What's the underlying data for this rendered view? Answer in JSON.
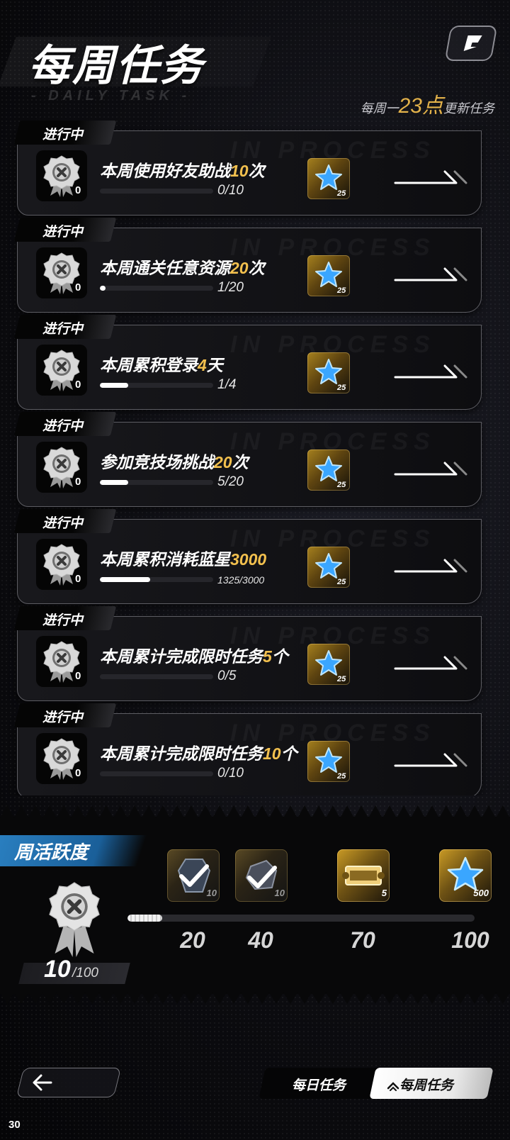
{
  "header": {
    "title": "每周任务",
    "subtitle_deco": "- DAILY TASK -",
    "reset_prefix": "每周一",
    "reset_hour": "23点",
    "reset_suffix": "更新任务"
  },
  "status_label": "进行中",
  "card_watermark": "IN PROCESS",
  "tasks": [
    {
      "name_pre": "本周使用好友助战",
      "name_hl": "10",
      "name_post": "次",
      "medal_count": "0",
      "progress_text": "0/10",
      "current": 0,
      "target": 10,
      "reward_count": "25"
    },
    {
      "name_pre": "本周通关任意资源",
      "name_hl": "20",
      "name_post": "次",
      "medal_count": "0",
      "progress_text": "1/20",
      "current": 1,
      "target": 20,
      "reward_count": "25"
    },
    {
      "name_pre": "本周累积登录",
      "name_hl": "4",
      "name_post": "天",
      "medal_count": "0",
      "progress_text": "1/4",
      "current": 1,
      "target": 4,
      "reward_count": "25"
    },
    {
      "name_pre": "参加竞技场挑战",
      "name_hl": "20",
      "name_post": "次",
      "medal_count": "0",
      "progress_text": "5/20",
      "current": 5,
      "target": 20,
      "reward_count": "25"
    },
    {
      "name_pre": "本周累积消耗蓝星",
      "name_hl": "3000",
      "name_post": "",
      "medal_count": "0",
      "progress_text": "1325/3000",
      "current": 1325,
      "target": 3000,
      "reward_count": "25"
    },
    {
      "name_pre": "本周累计完成限时任务",
      "name_hl": "5",
      "name_post": "个",
      "medal_count": "0",
      "progress_text": "0/5",
      "current": 0,
      "target": 5,
      "reward_count": "25"
    },
    {
      "name_pre": "本周累计完成限时任务",
      "name_hl": "10",
      "name_post": "个",
      "medal_count": "0",
      "progress_text": "0/10",
      "current": 0,
      "target": 10,
      "reward_count": "25"
    }
  ],
  "activity": {
    "label": "周活跃度",
    "score": "10",
    "max_label": "/100",
    "value": 10,
    "max": 100,
    "milestones": [
      {
        "threshold": "20",
        "reward_count": "10",
        "icon": "pickaxe-check-icon",
        "style": "dark",
        "dim": true
      },
      {
        "threshold": "40",
        "reward_count": "10",
        "icon": "ore-check-icon",
        "style": "dark",
        "dim": true
      },
      {
        "threshold": "70",
        "reward_count": "5",
        "icon": "ticket-icon",
        "style": "gold",
        "dim": false
      },
      {
        "threshold": "100",
        "reward_count": "500",
        "icon": "blue-star-icon",
        "style": "gold",
        "dim": false
      }
    ]
  },
  "bottom": {
    "tab_daily": "每日任务",
    "tab_weekly": "每周任务",
    "fps": "30"
  },
  "colors": {
    "highlight": "#f2c04e",
    "activity_blue": "#1f6fae",
    "gold": "#a5801e"
  }
}
